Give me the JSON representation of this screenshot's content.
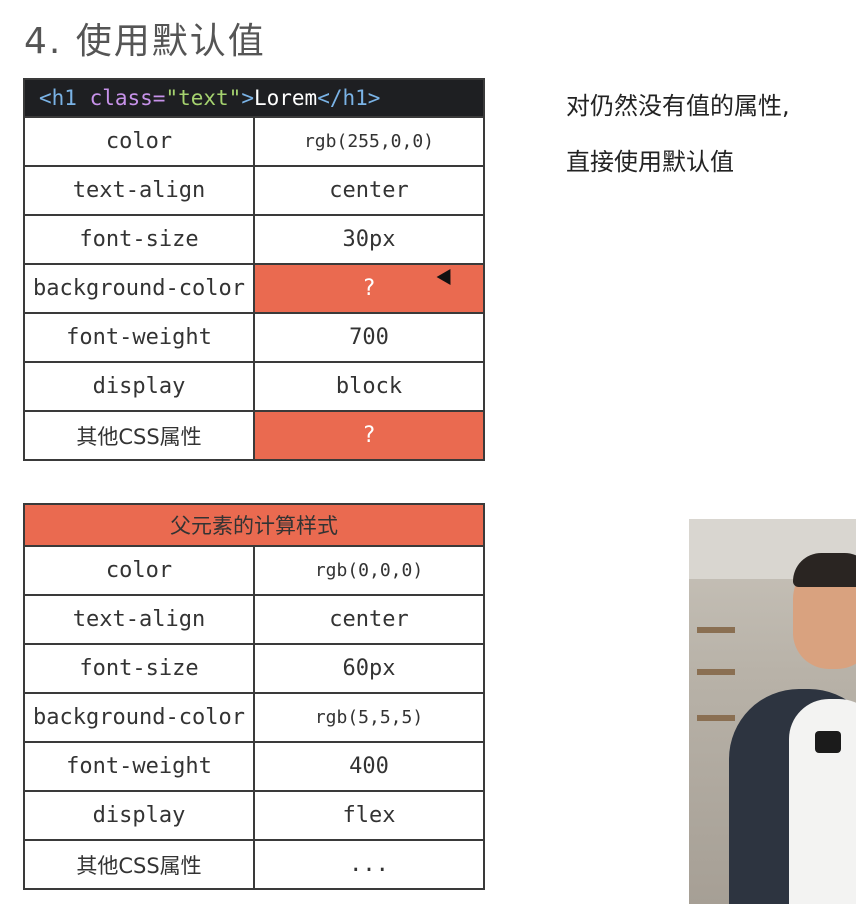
{
  "title": "4. 使用默认值",
  "code_head": {
    "lt": "<",
    "tag": "h1",
    "attr": " class=",
    "value": "\"text\"",
    "gt": ">",
    "text": "Lorem",
    "close": "</h1>"
  },
  "table1": {
    "rows": [
      {
        "prop": "color",
        "value": "rgb(255,0,0)"
      },
      {
        "prop": "text-align",
        "value": "center"
      },
      {
        "prop": "font-size",
        "value": "30px"
      },
      {
        "prop": "background-color",
        "value": "?"
      },
      {
        "prop": "font-weight",
        "value": "700"
      },
      {
        "prop": "display",
        "value": "block"
      },
      {
        "prop": "其他CSS属性",
        "value": "?"
      }
    ]
  },
  "table2": {
    "header": "父元素的计算样式",
    "rows": [
      {
        "prop": "color",
        "value": "rgb(0,0,0)"
      },
      {
        "prop": "text-align",
        "value": "center"
      },
      {
        "prop": "font-size",
        "value": "60px"
      },
      {
        "prop": "background-color",
        "value": "rgb(5,5,5)"
      },
      {
        "prop": "font-weight",
        "value": "400"
      },
      {
        "prop": "display",
        "value": "flex"
      },
      {
        "prop": "其他CSS属性",
        "value": "..."
      }
    ]
  },
  "note": {
    "line1": "对仍然没有值的属性,",
    "line2": "直接使用默认值"
  },
  "colors": {
    "highlight": "#ea6a50",
    "code_bg": "#1e1f22"
  }
}
